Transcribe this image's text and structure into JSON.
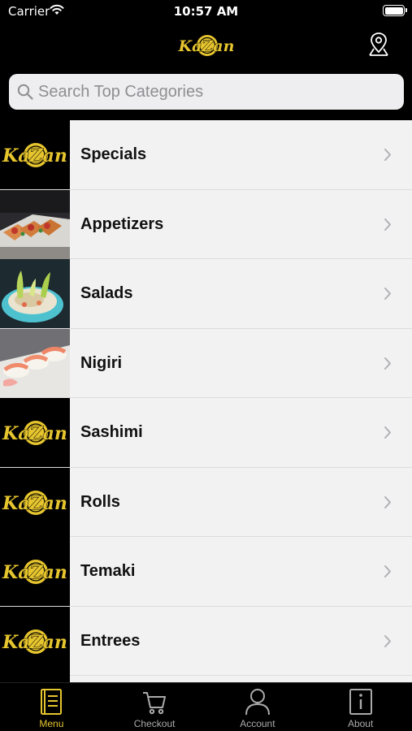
{
  "status_bar": {
    "carrier": "Carrier",
    "time": "10:57 AM"
  },
  "header": {
    "logo_text": "KaZan"
  },
  "search": {
    "placeholder": "Search Top Categories",
    "value": ""
  },
  "categories": [
    {
      "label": "Specials",
      "thumb": "kazan-logo"
    },
    {
      "label": "Appetizers",
      "thumb": "appetizers-photo"
    },
    {
      "label": "Salads",
      "thumb": "salad-photo"
    },
    {
      "label": "Nigiri",
      "thumb": "nigiri-photo"
    },
    {
      "label": "Sashimi",
      "thumb": "kazan-logo"
    },
    {
      "label": "Rolls",
      "thumb": "kazan-logo"
    },
    {
      "label": "Temaki",
      "thumb": "kazan-logo"
    },
    {
      "label": "Entrees",
      "thumb": "kazan-logo"
    }
  ],
  "tabs": [
    {
      "label": "Menu",
      "icon": "menu-icon",
      "active": true
    },
    {
      "label": "Checkout",
      "icon": "cart-icon",
      "active": false
    },
    {
      "label": "Account",
      "icon": "person-icon",
      "active": false
    },
    {
      "label": "About",
      "icon": "info-icon",
      "active": false
    }
  ],
  "colors": {
    "accent": "#e6c52e",
    "background": "#000000",
    "list_bg": "#f2f2f2"
  }
}
